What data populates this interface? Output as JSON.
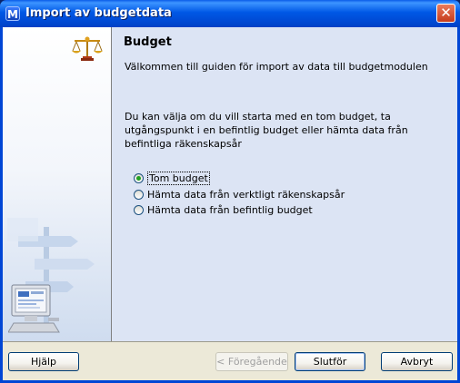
{
  "window": {
    "title": "Import av budgetdata",
    "app_icon": "M",
    "close_glyph": "✕"
  },
  "main": {
    "heading": "Budget",
    "welcome": "Välkommen till guiden för import av data till budgetmodulen",
    "intro": "Du kan välja om du vill starta med en tom budget, ta utgångspunkt i en befintlig budget eller hämta data från befintliga räkenskapsår",
    "options": [
      {
        "label": "Tom budget",
        "selected": true
      },
      {
        "label": "Hämta data från verktligt räkenskapsår",
        "selected": false
      },
      {
        "label": "Hämta data från befintlig budget",
        "selected": false
      }
    ]
  },
  "buttons": {
    "help": "Hjälp",
    "back": "< Föregående",
    "finish": "Slutför",
    "cancel": "Avbryt"
  },
  "icons": {
    "scales": "scales-icon",
    "signpost": "signpost-illustration",
    "computer": "computer-illustration"
  },
  "colors": {
    "titlebar": "#0058e6",
    "main_panel": "#dce4f4",
    "dialog_face": "#ece9d8",
    "radio_dot": "#21a121"
  }
}
